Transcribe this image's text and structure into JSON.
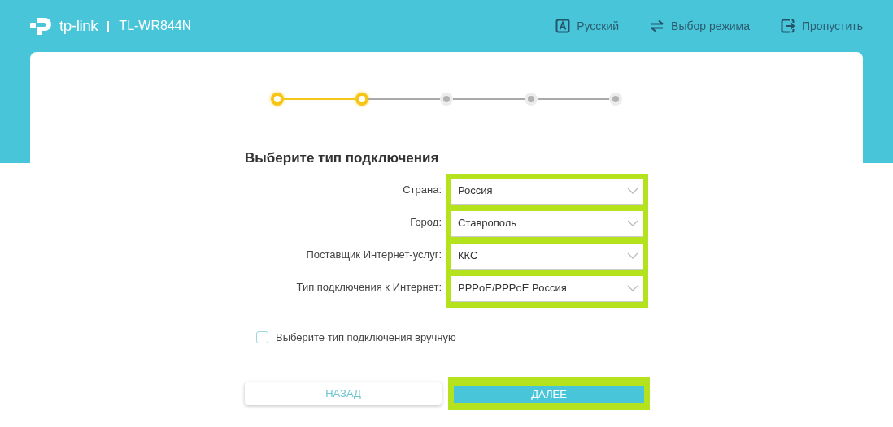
{
  "header": {
    "brand": "tp-link",
    "model": "TL-WR844N",
    "actions": [
      {
        "kind": "language",
        "label": "Русский"
      },
      {
        "kind": "mode",
        "label": "Выбор режима"
      },
      {
        "kind": "skip",
        "label": "Пропустить"
      }
    ]
  },
  "steps": [
    {
      "completed": true
    },
    {
      "completed": true
    },
    {
      "completed": false
    },
    {
      "completed": false
    },
    {
      "completed": false
    }
  ],
  "title": "Выберите тип подключения",
  "fields_highlighted": true,
  "fields": [
    {
      "label": "Страна:",
      "value": "Россия"
    },
    {
      "label": "Город:",
      "value": "Ставрополь"
    },
    {
      "label": "Поставщик Интернет-услуг:",
      "value": "ККС"
    },
    {
      "label": "Тип подключения к Интернет:",
      "value": "PPPoE/PPPoE Россия"
    }
  ],
  "manual": {
    "label": "Выберите тип подключения вручную",
    "checked": false
  },
  "buttons": [
    {
      "kind": "secondary",
      "label": "НАЗАД",
      "highlighted": false
    },
    {
      "kind": "primary",
      "label": "ДАЛЕЕ",
      "highlighted": true
    }
  ]
}
